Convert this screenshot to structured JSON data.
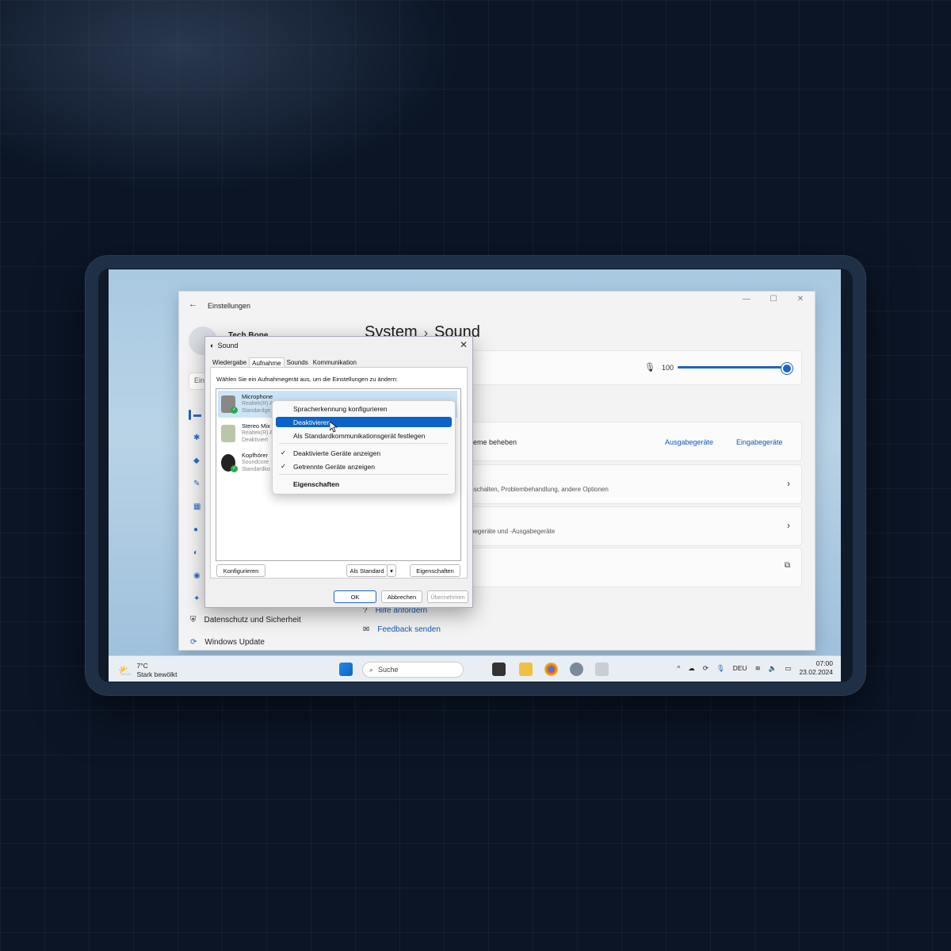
{
  "settings": {
    "window_title": "Einstellungen",
    "breadcrumb_parent": "System",
    "breadcrumb_sep": "›",
    "breadcrumb_current": "Sound",
    "user_name": "Tech Bone",
    "search_placeholder": "Ein",
    "sidebar_items": [
      {
        "label": "Datenschutz und Sicherheit",
        "icon": "shield-icon"
      },
      {
        "label": "Windows Update",
        "icon": "update-icon"
      }
    ],
    "volume_value": "100",
    "volume_level_percent": 100,
    "troubleshoot_text": "obleme beheben",
    "troubleshoot_output_link": "Ausgabegeräte",
    "troubleshoot_input_link": "Eingabegeräte",
    "card2_text": "ausschalten, Problembehandlung, andere Optionen",
    "card3_text": "gabegeräte und -Ausgabegeräte",
    "help_label": "Hilfe anfordern",
    "feedback_label": "Feedback senden",
    "accent_color": "#1d65c1"
  },
  "sound_dialog": {
    "title": "Sound",
    "close": "✕",
    "tabs": [
      "Wiedergabe",
      "Aufnahme",
      "Sounds",
      "Kommunikation"
    ],
    "active_tab": "Aufnahme",
    "instruction": "Wählen Sie ein Aufnahmegerät aus, um die Einstellungen zu ändern:",
    "devices": [
      {
        "name": "Microphone",
        "line1": "Realtek(R) A",
        "line2": "Standardge"
      },
      {
        "name": "Stereo Mix",
        "line1": "Realtek(R) A",
        "line2": "Deaktiviert"
      },
      {
        "name": "Kopfhörer",
        "line1": "Soundcore",
        "line2": "Standardko"
      }
    ],
    "configure_button": "Konfigurieren",
    "set_default_button": "Als Standard",
    "properties_button": "Eigenschaften",
    "ok_button": "OK",
    "cancel_button": "Abbrechen",
    "apply_button": "Übernehmen"
  },
  "context_menu": {
    "items": [
      {
        "label": "Spracherkennung konfigurieren"
      },
      {
        "label": "Deaktivieren"
      },
      {
        "label": "Als Standardkommunikationsgerät festlegen"
      },
      {
        "label": "Deaktivierte Geräte anzeigen",
        "checked": true
      },
      {
        "label": "Getrennte Geräte anzeigen",
        "checked": true
      },
      {
        "label": "Eigenschaften",
        "bold": true
      }
    ],
    "highlighted": "Deaktivieren"
  },
  "taskbar": {
    "temperature": "7°C",
    "weather_text": "Stark bewölkt",
    "search_label": "Suche",
    "language": "DEU",
    "time": "07:00",
    "date": "23.02.2024"
  }
}
